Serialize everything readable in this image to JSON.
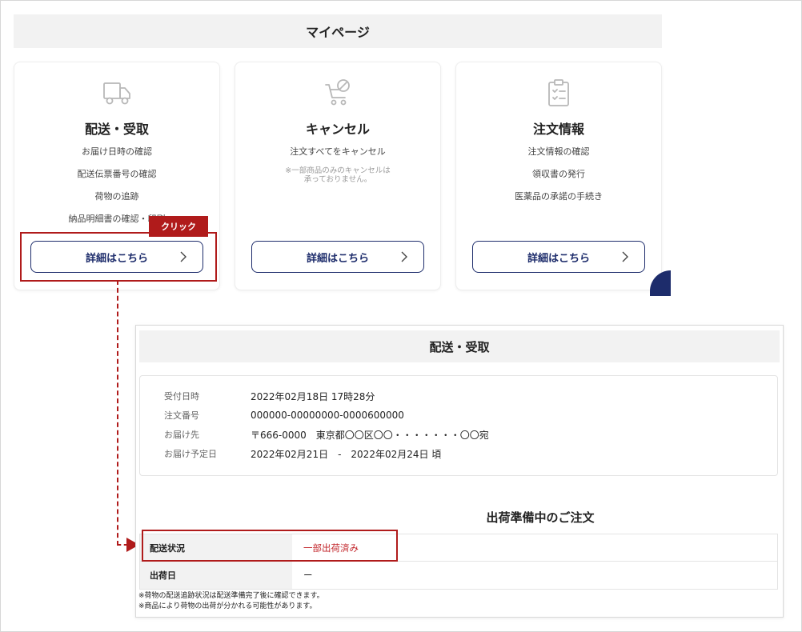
{
  "mypage": {
    "title": "マイページ"
  },
  "cards": [
    {
      "icon": "delivery-truck-icon",
      "title": "配送・受取",
      "lines": [
        "お届け日時の確認",
        "配送伝票番号の確認",
        "荷物の追跡",
        "納品明細書の確認・印刷"
      ],
      "button": "詳細はこちら"
    },
    {
      "icon": "cart-cancel-icon",
      "title": "キャンセル",
      "lines": [
        "注文すべてをキャンセル"
      ],
      "note": [
        "※一部商品のみのキャンセルは",
        "承っておりません。"
      ],
      "button": "詳細はこちら"
    },
    {
      "icon": "clipboard-checklist-icon",
      "title": "注文情報",
      "lines": [
        "注文情報の確認",
        "領収書の発行",
        "医薬品の承諾の手続き"
      ],
      "button": "詳細はこちら"
    }
  ],
  "annotation": {
    "click_label": "クリック",
    "accent_color": "#b01b1b"
  },
  "detail": {
    "header": "配送・受取",
    "info": [
      {
        "label": "受付日時",
        "value": "2022年02月18日 17時28分"
      },
      {
        "label": "注文番号",
        "value": "000000-00000000-0000600000"
      },
      {
        "label": "お届け先",
        "value": "〒666-0000　東京都〇〇区〇〇・・・・・・・〇〇宛"
      },
      {
        "label": "お届け予定日",
        "value": "2022年02月21日　-　2022年02月24日 頃"
      }
    ],
    "section_title": "出荷準備中のご注文",
    "status_rows": [
      {
        "key": "配送状況",
        "value": "一部出荷済み"
      },
      {
        "key": "出荷日",
        "value": "ー"
      }
    ],
    "notes": [
      "※荷物の配送追跡状況は配送準備完了後に確認できます。",
      "※商品により荷物の出荷が分かれる可能性があります。"
    ]
  },
  "colors": {
    "navy": "#1d2c6b",
    "red": "#b01b1b",
    "status_red": "#c2262b",
    "header_gray": "#f2f2f2"
  }
}
